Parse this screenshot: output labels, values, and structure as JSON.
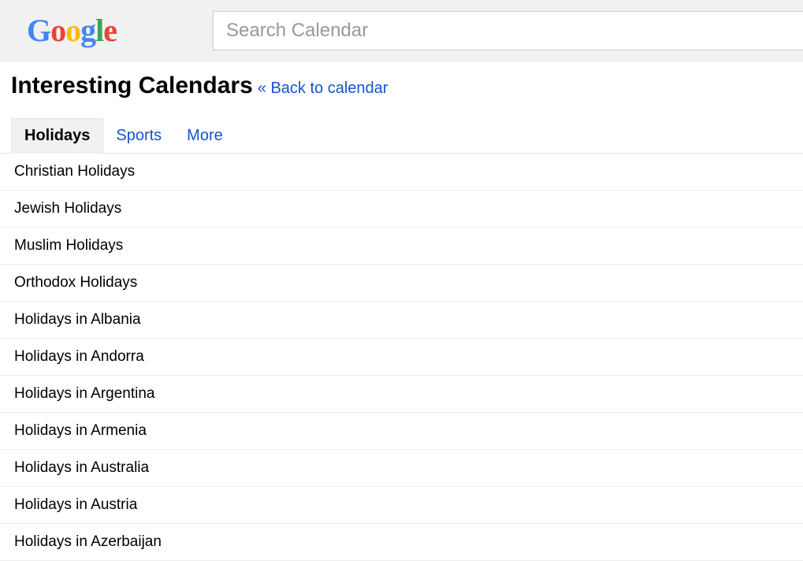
{
  "header": {
    "search_placeholder": "Search Calendar"
  },
  "title_row": {
    "page_title": "Interesting Calendars",
    "back_link": "« Back to calendar"
  },
  "tabs": [
    {
      "label": "Holidays",
      "active": true
    },
    {
      "label": "Sports",
      "active": false
    },
    {
      "label": "More",
      "active": false
    }
  ],
  "calendars": [
    "Christian Holidays",
    "Jewish Holidays",
    "Muslim Holidays",
    "Orthodox Holidays",
    "Holidays in Albania",
    "Holidays in Andorra",
    "Holidays in Argentina",
    "Holidays in Armenia",
    "Holidays in Australia",
    "Holidays in Austria",
    "Holidays in Azerbaijan"
  ]
}
